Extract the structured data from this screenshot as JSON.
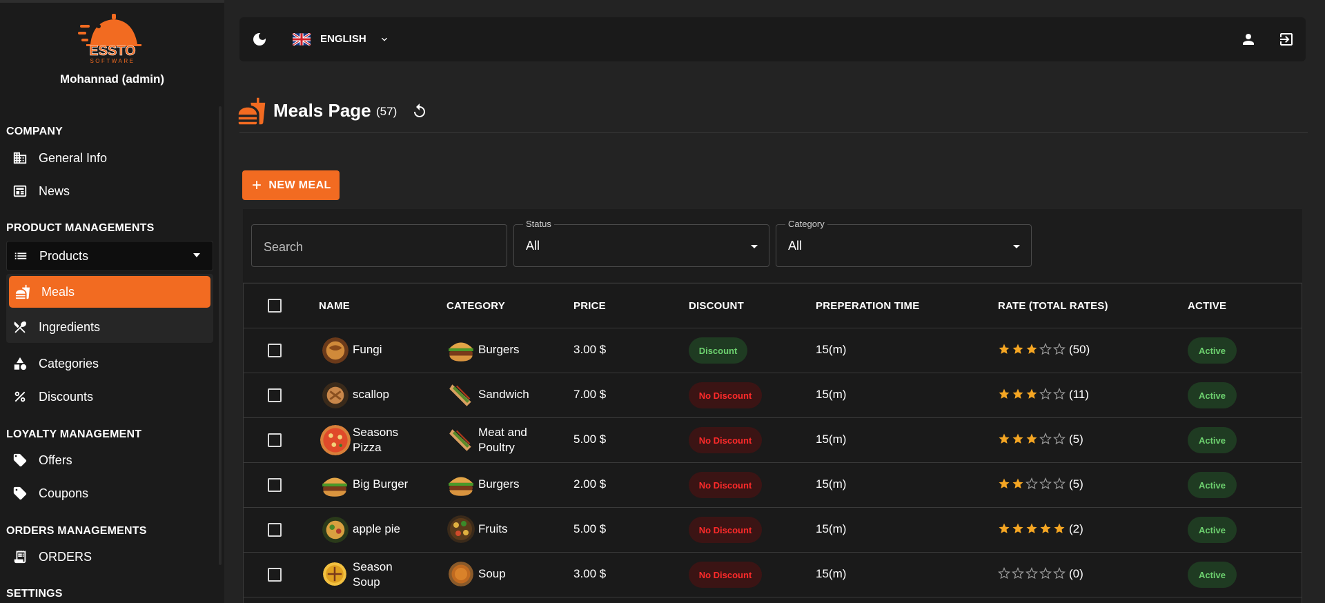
{
  "sidebar": {
    "logo_text": "ESSTO",
    "logo_sub": "SOFTWARE",
    "user_name": "Mohannad (admin)",
    "sections": {
      "company": "COMPANY",
      "product": "PRODUCT MANAGEMENTS",
      "loyalty": "LOYALTY MANAGEMENT",
      "orders": "ORDERS MANAGEMENTS",
      "settings": "SETTINGS"
    },
    "items": {
      "general_info": "General Info",
      "news": "News",
      "products": "Products",
      "meals": "Meals",
      "ingredients": "Ingredients",
      "categories": "Categories",
      "discounts": "Discounts",
      "offers": "Offers",
      "coupons": "Coupons",
      "orders": "ORDERS"
    }
  },
  "topbar": {
    "language": "ENGLISH",
    "icons": [
      "moon-icon",
      "uk-flag-icon",
      "chevron-down-icon",
      "user-icon",
      "logout-icon"
    ]
  },
  "page": {
    "title": "Meals Page",
    "count": "(57)",
    "new_button": "NEW MEAL"
  },
  "filters": {
    "search_placeholder": "Search",
    "status_label": "Status",
    "status_value": "All",
    "category_label": "Category",
    "category_value": "All"
  },
  "table": {
    "headers": {
      "name": "NAME",
      "category": "CATEGORY",
      "price": "PRICE",
      "discount": "DISCOUNT",
      "prep": "PREPERATION TIME",
      "rate": "RATE (TOTAL RATES)",
      "active": "ACTIVE"
    },
    "rows": [
      {
        "name": "Fungi",
        "category": "Burgers",
        "price": "3.00 $",
        "discount": "Discount",
        "prep": "15(m)",
        "rating": 3,
        "total": "(50)",
        "active": "Active"
      },
      {
        "name": "scallop",
        "category": "Sandwich",
        "price": "7.00 $",
        "discount": "No Discount",
        "prep": "15(m)",
        "rating": 3,
        "total": "(11)",
        "active": "Active"
      },
      {
        "name": "Seasons Pizza",
        "name_l1": "Seasons",
        "name_l2": "Pizza",
        "category": "Meat and Poultry",
        "cat_l1": "Meat and",
        "cat_l2": "Poultry",
        "price": "5.00 $",
        "discount": "No Discount",
        "prep": "15(m)",
        "rating": 3,
        "total": "(5)",
        "active": "Active"
      },
      {
        "name": "Big Burger",
        "category": "Burgers",
        "price": "2.00 $",
        "discount": "No Discount",
        "prep": "15(m)",
        "rating": 2,
        "total": "(5)",
        "active": "Active"
      },
      {
        "name": "apple pie",
        "category": "Fruits",
        "price": "5.00 $",
        "discount": "No Discount",
        "prep": "15(m)",
        "rating": 5,
        "total": "(2)",
        "active": "Active"
      },
      {
        "name": "Season Soup",
        "name_l1": "Season",
        "name_l2": "Soup",
        "category": "Soup",
        "price": "3.00 $",
        "discount": "No Discount",
        "prep": "15(m)",
        "rating": 0,
        "total": "(0)",
        "active": "Active"
      }
    ]
  },
  "colors": {
    "accent": "#f26b21",
    "star": "#f5a623",
    "active_text": "#6dd16f",
    "no_discount_text": "#ff2a2a"
  }
}
